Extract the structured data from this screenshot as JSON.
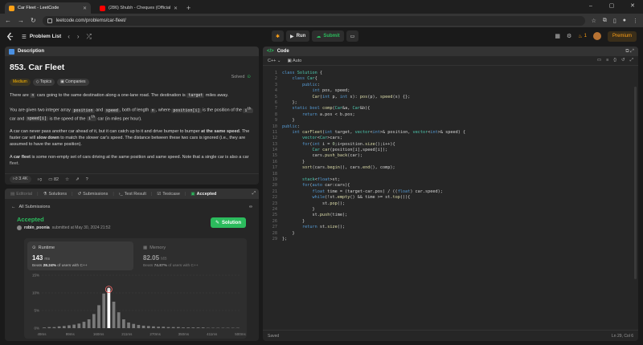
{
  "browser": {
    "tabs": [
      {
        "title": "Car Fleet - LeetCode",
        "color": "#ffa116",
        "active": true
      },
      {
        "title": "(286) Shubh - Cheques (Official",
        "color": "#ff0000",
        "active": false
      }
    ],
    "new_tab": "+",
    "url": "leetcode.com/problems/car-fleet/"
  },
  "header": {
    "problem_list": "Problem List",
    "run": "Run",
    "submit": "Submit",
    "streak": "1",
    "premium": "Premium"
  },
  "description": {
    "tab": "Description",
    "title": "853. Car Fleet",
    "solved": "Solved",
    "tags": [
      "Medium",
      "Topics",
      "Companies"
    ],
    "p1": {
      "a": "There are ",
      "code1": "n",
      "b": " cars going to the same destination along a one-lane road. The destination is ",
      "code2": "target",
      "c": " miles away."
    },
    "p2": {
      "a": "You are given two integer array ",
      "code1": "position",
      "b": " and ",
      "code2": "speed",
      "c": ", both of length ",
      "code3": "n",
      "d": ", where ",
      "code4": "position[i]",
      "e": " is the position of the ",
      "sup1": "i",
      "th1": "th",
      "f": " car and ",
      "code5": "speed[i]",
      "g": " is the speed of the ",
      "th2": "th",
      "h": " car (in miles per hour)."
    },
    "p3": {
      "a": "A car can never pass another car ahead of it, but it can catch up to it and drive bumper to bumper ",
      "b1": "at the same speed",
      "b": ". The faster car will ",
      "b2": "slow down",
      "c": " to match the slower car's speed. The distance between these two cars is ignored (i.e., they are assumed to have the same position)."
    },
    "p4": {
      "a": "A ",
      "b1": "car fleet",
      "b": " is some non-empty set of cars driving at the same position and same speed. Note that a single car is also a car fleet."
    },
    "likes": "3.4K",
    "comments": "82"
  },
  "result": {
    "tabs": [
      "Editorial",
      "Solutions",
      "Submissions",
      "Test Result",
      "Testcase",
      "Accepted"
    ],
    "back": "All Submissions",
    "status": "Accepted",
    "user": "robin_poonia",
    "submitted": "submitted at May 30, 2024 21:52",
    "solution_btn": "Solution",
    "runtime": {
      "label": "Runtime",
      "value": "143",
      "unit": "ms",
      "beats_pct": "28.24%",
      "beats_prefix": "Beats",
      "beats_suffix": "of users with C++"
    },
    "memory": {
      "label": "Memory",
      "value": "82.05",
      "unit": "MB",
      "beats_pct": "74.87%",
      "beats_prefix": "Beats",
      "beats_suffix": "of users with C++"
    }
  },
  "chart_data": {
    "type": "bar",
    "title": "",
    "xlabel": "",
    "ylabel": "",
    "y_ticks": [
      "15%",
      "10%",
      "5%",
      "0%"
    ],
    "ylim": [
      0,
      15
    ],
    "x_ticks": [
      "49ms",
      "99ms",
      "160ms",
      "211ms",
      "270ms",
      "350ms",
      "411ms",
      "500ms"
    ],
    "values": [
      0.2,
      0.3,
      0.3,
      0.5,
      0.6,
      0.8,
      1.0,
      1.3,
      1.8,
      2.5,
      4.0,
      6.5,
      9.8,
      11.0,
      7.5,
      4.5,
      2.5,
      1.6,
      1.2,
      0.9,
      0.7,
      0.6,
      0.5,
      0.4,
      0.4,
      0.3,
      0.3,
      0.3,
      0.2,
      0.2,
      0.2,
      0.2,
      0.2,
      0.1,
      0.1,
      0.1,
      0.1,
      0.1,
      0.1,
      0.1
    ],
    "highlight_index": 13,
    "bar_color": "#7a7a7a",
    "highlight_color": "#ffffff",
    "grid": true
  },
  "code": {
    "tab": "Code",
    "lang": "C++",
    "mode": "Auto",
    "status_left": "Saved",
    "status_right": "Ln 29, Col 6"
  }
}
